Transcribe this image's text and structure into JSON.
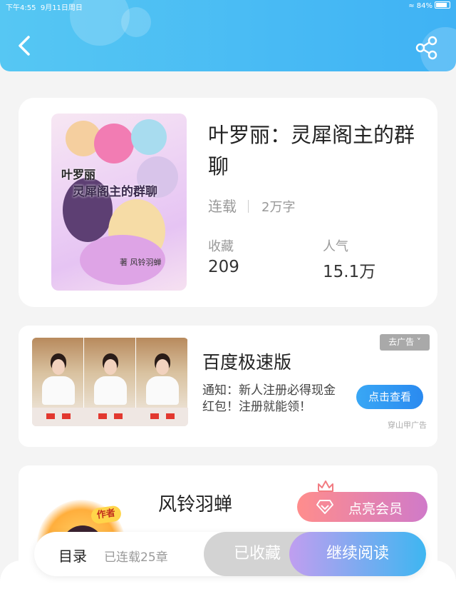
{
  "status_bar": {
    "time": "下午4:55",
    "date": "9月11日周日",
    "battery": "84%"
  },
  "book": {
    "title": "叶罗丽：灵犀阁主的群聊",
    "status": "连载",
    "words": "2万字",
    "favorites_label": "收藏",
    "favorites_value": "209",
    "popularity_label": "人气",
    "popularity_value": "15.1万",
    "cover": {
      "title_line1": "叶罗丽",
      "title_line2": "灵犀阁主的群聊",
      "author_line": "著 风铃羽蝉"
    }
  },
  "ad": {
    "title": "百度极速版",
    "description": "通知：新人注册必得现金红包！注册就能领！",
    "remove_tag": "去广告 ˅",
    "button": "点击查看",
    "source": "穿山甲广告"
  },
  "author": {
    "name": "风铃羽蝉",
    "badge": "作者",
    "vip_button": "点亮会员"
  },
  "bottom_bar": {
    "toc": "目录",
    "chapters": "已连载25章",
    "collected": "已收藏",
    "continue": "继续阅读"
  },
  "colors": {
    "header": "#3fb2f4",
    "vip_start": "#ff8d8c",
    "vip_end": "#d07ac9",
    "continue_start": "#c09ef0",
    "continue_end": "#3eb6f1"
  }
}
